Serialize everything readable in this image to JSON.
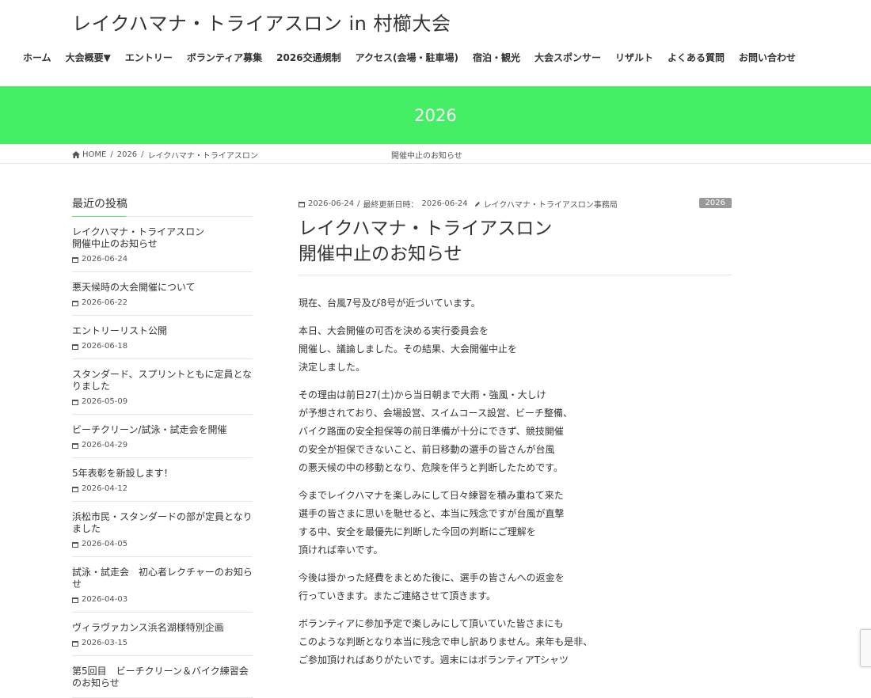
{
  "site_title": "レイクハマナ・トライアスロン in 村櫛大会",
  "nav": [
    "ホーム",
    "大会概要▼",
    "エントリー",
    "ボランティア募集",
    "2026交通規制",
    "アクセス(会場・駐車場)",
    "宿泊・観光",
    "大会スポンサー",
    "リザルト",
    "よくある質問",
    "お問い合わせ"
  ],
  "banner_title": "2026",
  "breadcrumb": {
    "home": "HOME",
    "sep": "/",
    "cat": "2026",
    "post": "レイクハマナ・トライアスロン",
    "post_cont": "開催中止のお知らせ"
  },
  "sidebar": {
    "title": "最近の投稿",
    "posts": [
      {
        "title": "レイクハマナ・トライアスロン\n開催中止のお知らせ",
        "date": "2026-06-24"
      },
      {
        "title": "悪天候時の大会開催について",
        "date": "2026-06-22"
      },
      {
        "title": "エントリーリスト公開",
        "date": "2026-06-18"
      },
      {
        "title": "スタンダード、スプリントともに定員となりました",
        "date": "2026-05-09"
      },
      {
        "title": "ビーチクリーン/試泳・試走会を開催",
        "date": "2026-04-29"
      },
      {
        "title": "5年表彰を新設します！",
        "date": "2026-04-12"
      },
      {
        "title": "浜松市民・スタンダードの部が定員となりました",
        "date": "2026-04-05"
      },
      {
        "title": "試泳・試走会　初心者レクチャーのお知らせ",
        "date": "2026-04-03"
      },
      {
        "title": "ヴィラヴァカンス浜名湖様特別企画",
        "date": "2026-03-15"
      },
      {
        "title": "第5回目　ビーチクリーン＆バイク練習会のお知らせ",
        "date": ""
      }
    ]
  },
  "article": {
    "date": "2026-06-24",
    "updated_label": "最終更新日時：",
    "updated": "2026-06-24",
    "author": "レイクハマナ・トライアスロン事務局",
    "category": "2026",
    "title_line1": "レイクハマナ・トライアスロン",
    "title_line2": "開催中止のお知らせ",
    "paragraphs": [
      [
        "現在、台風7号及び8号が近づいています。"
      ],
      [
        "本日、大会開催の可否を決める実行委員会を",
        "開催し、議論しました。その結果、大会開催中止を",
        "決定しました。"
      ],
      [
        "その理由は前日27(土)から当日朝まで大雨・強風・大しけ",
        "が予想されており、会場設営、スイムコース設営、ビーチ整備、",
        "バイク路面の安全担保等の前日準備が十分にできず、競技開催",
        "の安全が担保できないこと、前日移動の選手の皆さんが台風",
        "の悪天候の中の移動となり、危険を伴うと判断したためです。"
      ],
      [
        "今までレイクハマナを楽しみにして日々練習を積み重ねて来た",
        "選手の皆さまに思いを馳せると、本当に残念ですが台風が直撃",
        "する中、安全を最優先に判断した今回の判断にご理解を",
        "頂ければ幸いです。"
      ],
      [
        "今後は掛かった経費をまとめた後に、選手の皆さんへの返金を",
        "行っていきます。またご連絡させて頂きます。"
      ],
      [
        "ボランティアに参加予定で楽しみにして頂いていた皆さまにも",
        "このような判断となり本当に残念で申し訳ありません。来年も是非、",
        "ご参加頂ければありがたいです。週末にはボランティアTシャツ"
      ]
    ]
  },
  "colors": {
    "accent": "#44ef66",
    "badge": "#999999",
    "text": "#333333"
  }
}
